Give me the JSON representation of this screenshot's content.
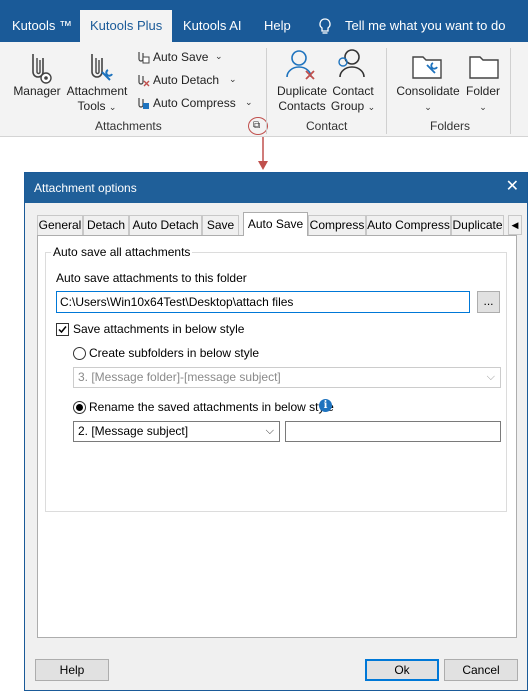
{
  "ribbon": {
    "tabs": [
      "Kutools ™",
      "Kutools Plus",
      "Kutools AI",
      "Help"
    ],
    "tell_me": "Tell me what you want to do",
    "attachments": {
      "manager": "Manager",
      "attachment_tools_1": "Attachment",
      "attachment_tools_2": "Tools",
      "auto_save": "Auto Save",
      "auto_detach": "Auto Detach",
      "auto_compress": "Auto Compress",
      "group": "Attachments"
    },
    "contact": {
      "duplicate_1": "Duplicate",
      "duplicate_2": "Contacts",
      "contact_group_1": "Contact",
      "contact_group_2": "Group",
      "group": "Contact"
    },
    "folders": {
      "consolidate": "Consolidate",
      "folder": "Folder",
      "group": "Folders"
    }
  },
  "dialog": {
    "title": "Attachment options",
    "tabs": [
      "General",
      "Detach",
      "Auto Detach",
      "Save",
      "Auto Save",
      "Compress",
      "Auto Compress",
      "Duplicate"
    ],
    "active_tab": "Auto Save",
    "group_title": "Auto save all attachments",
    "folder_label": "Auto save attachments to this folder",
    "folder_path": "C:\\Users\\Win10x64Test\\Desktop\\attach files",
    "browse_label": "...",
    "style_checkbox_label": "Save attachments in below style",
    "style_checkbox_checked": true,
    "subfolder_radio_label": "Create subfolders in below style",
    "subfolder_select_value": "3. [Message folder]-[message subject]",
    "rename_radio_label": "Rename the saved attachments in below style",
    "rename_select_value": "2. [Message subject]",
    "rename_extra_value": "",
    "help_button": "Help",
    "ok_button": "Ok",
    "cancel_button": "Cancel"
  },
  "colors": {
    "ribbon_blue": "#1a5a98",
    "dialog_title": "#1f5f99",
    "callout_red": "#c0504d",
    "info_blue": "#1e73be"
  }
}
